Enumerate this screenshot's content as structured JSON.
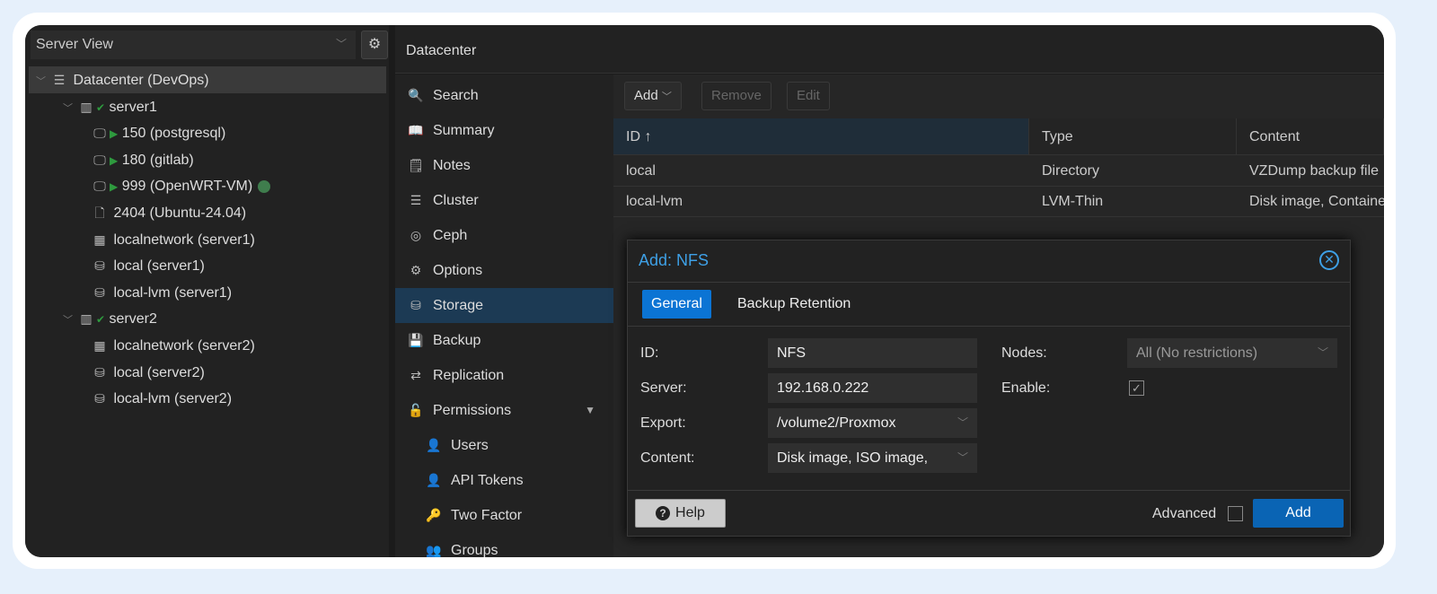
{
  "sidebar": {
    "view": "Server View",
    "tree": [
      {
        "label": "Datacenter (DevOps)",
        "icon": "datacenter-icon"
      },
      {
        "label": "server1",
        "icon": "server-online-icon"
      },
      {
        "label": "150 (postgresql)",
        "icon": "vm-running-icon"
      },
      {
        "label": "180 (gitlab)",
        "icon": "vm-running-icon"
      },
      {
        "label": "999 (OpenWRT-VM)",
        "icon": "vm-running-icon"
      },
      {
        "label": "2404 (Ubuntu-24.04)",
        "icon": "template-icon"
      },
      {
        "label": "localnetwork (server1)",
        "icon": "network-icon"
      },
      {
        "label": "local (server1)",
        "icon": "storage-icon"
      },
      {
        "label": "local-lvm (server1)",
        "icon": "storage-icon"
      },
      {
        "label": "server2",
        "icon": "server-online-icon"
      },
      {
        "label": "localnetwork (server2)",
        "icon": "network-icon"
      },
      {
        "label": "local (server2)",
        "icon": "storage-icon"
      },
      {
        "label": "local-lvm (server2)",
        "icon": "storage-icon"
      }
    ]
  },
  "header": {
    "title": "Datacenter"
  },
  "nav": [
    "Search",
    "Summary",
    "Notes",
    "Cluster",
    "Ceph",
    "Options",
    "Storage",
    "Backup",
    "Replication",
    "Permissions",
    "Users",
    "API Tokens",
    "Two Factor",
    "Groups"
  ],
  "toolbar": {
    "add": "Add",
    "remove": "Remove",
    "edit": "Edit"
  },
  "table": {
    "columns": [
      "ID ↑",
      "Type",
      "Content"
    ],
    "rows": [
      [
        "local",
        "Directory",
        "VZDump backup file"
      ],
      [
        "local-lvm",
        "LVM-Thin",
        "Disk image, Container"
      ]
    ]
  },
  "dialog": {
    "title": "Add: NFS",
    "tabs": [
      "General",
      "Backup Retention"
    ],
    "fields": {
      "id_label": "ID:",
      "id": "NFS",
      "server_label": "Server:",
      "server": "192.168.0.222",
      "export_label": "Export:",
      "export": "/volume2/Proxmox",
      "content_label": "Content:",
      "content": "Disk image, ISO image,",
      "nodes_label": "Nodes:",
      "nodes": "All (No restrictions)",
      "enable_label": "Enable:",
      "enable": true
    },
    "help": "Help",
    "advanced": "Advanced",
    "add": "Add"
  },
  "colors": {
    "accent": "#0b74d4",
    "title": "#3ea0e6",
    "running": "#2e9a3e"
  }
}
